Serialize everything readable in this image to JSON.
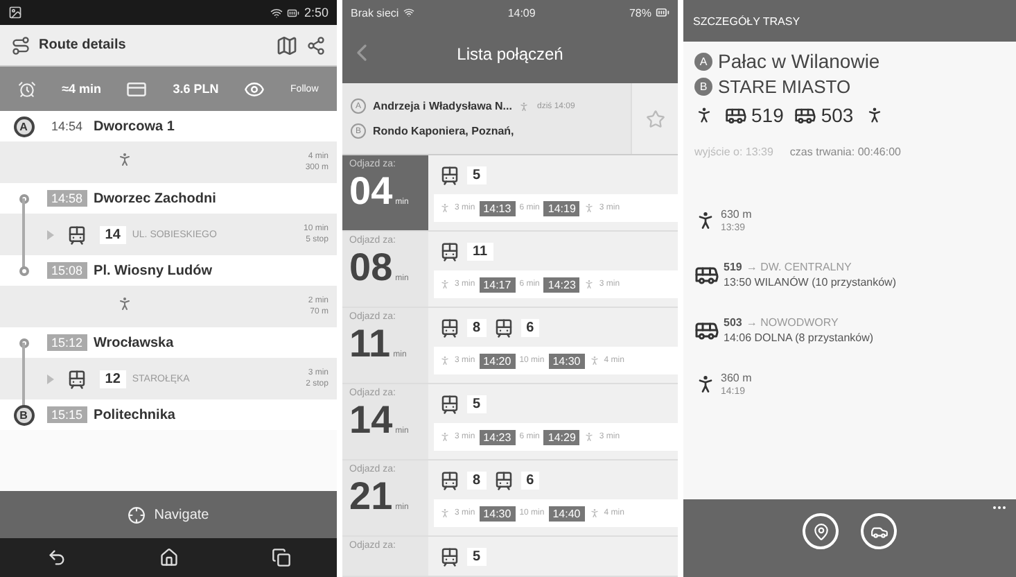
{
  "route_details": {
    "status_bar": {
      "time": "2:50"
    },
    "title": "Route details",
    "summary": {
      "duration": "≈4 min",
      "price": "3.6 PLN",
      "follow": "Follow"
    },
    "steps": [
      {
        "kind": "stop",
        "marker": "A",
        "time": "14:54",
        "name": "Dworcowa 1",
        "boxed": false
      },
      {
        "kind": "walk",
        "duration": "4 min",
        "distance": "300 m"
      },
      {
        "kind": "stop",
        "time": "14:58",
        "name": "Dworzec Zachodni",
        "boxed": true
      },
      {
        "kind": "tram",
        "line": "14",
        "direction": "UL. SOBIESKIEGO",
        "duration": "10 min",
        "stops": "5 stop"
      },
      {
        "kind": "stop",
        "time": "15:08",
        "name": "Pl. Wiosny Ludów",
        "boxed": true
      },
      {
        "kind": "walk",
        "duration": "2 min",
        "distance": "70 m"
      },
      {
        "kind": "stop",
        "time": "15:12",
        "name": "Wrocławska",
        "boxed": true
      },
      {
        "kind": "tram",
        "line": "12",
        "direction": "STAROŁĘKA",
        "duration": "3 min",
        "stops": "2 stop"
      },
      {
        "kind": "stop",
        "marker": "B",
        "time": "15:15",
        "name": "Politechnika",
        "boxed": true
      }
    ],
    "navigate": "Navigate"
  },
  "connections": {
    "status_bar": {
      "carrier": "Brak sieci",
      "time": "14:09",
      "battery": "78%"
    },
    "title": "Lista połączeń",
    "route": {
      "from_marker": "A",
      "from": "Andrzeja i Władysława N...",
      "to_marker": "B",
      "to": "Rondo Kaponiera, Poznań,",
      "info": "dziś 14:09"
    },
    "rows": [
      {
        "label": "Odjazd za:",
        "minutes": "04",
        "unit": "min",
        "selected": true,
        "lines": [
          "5"
        ],
        "legs": [
          {
            "kind": "walk",
            "text": "3 min"
          },
          {
            "kind": "time",
            "text": "14:13"
          },
          {
            "kind": "ride",
            "text": "6 min"
          },
          {
            "kind": "time",
            "text": "14:19"
          },
          {
            "kind": "walk",
            "text": "3 min"
          }
        ]
      },
      {
        "label": "Odjazd za:",
        "minutes": "08",
        "unit": "min",
        "selected": false,
        "lines": [
          "11"
        ],
        "legs": [
          {
            "kind": "walk",
            "text": "3 min"
          },
          {
            "kind": "time",
            "text": "14:17"
          },
          {
            "kind": "ride",
            "text": "6 min"
          },
          {
            "kind": "time",
            "text": "14:23"
          },
          {
            "kind": "walk",
            "text": "3 min"
          }
        ]
      },
      {
        "label": "Odjazd za:",
        "minutes": "11",
        "unit": "min",
        "selected": false,
        "lines": [
          "8",
          "6"
        ],
        "legs": [
          {
            "kind": "walk",
            "text": "3 min"
          },
          {
            "kind": "time",
            "text": "14:20"
          },
          {
            "kind": "ride",
            "text": "10 min"
          },
          {
            "kind": "time",
            "text": "14:30"
          },
          {
            "kind": "walk",
            "text": "4 min"
          }
        ]
      },
      {
        "label": "Odjazd za:",
        "minutes": "14",
        "unit": "min",
        "selected": false,
        "lines": [
          "5"
        ],
        "legs": [
          {
            "kind": "walk",
            "text": "3 min"
          },
          {
            "kind": "time",
            "text": "14:23"
          },
          {
            "kind": "ride",
            "text": "6 min"
          },
          {
            "kind": "time",
            "text": "14:29"
          },
          {
            "kind": "walk",
            "text": "3 min"
          }
        ]
      },
      {
        "label": "Odjazd za:",
        "minutes": "21",
        "unit": "min",
        "selected": false,
        "lines": [
          "8",
          "6"
        ],
        "legs": [
          {
            "kind": "walk",
            "text": "3 min"
          },
          {
            "kind": "time",
            "text": "14:30"
          },
          {
            "kind": "ride",
            "text": "10 min"
          },
          {
            "kind": "time",
            "text": "14:40"
          },
          {
            "kind": "walk",
            "text": "4 min"
          }
        ]
      },
      {
        "label": "Odjazd za:",
        "selected": false,
        "lines": [
          "5"
        ]
      }
    ]
  },
  "trip_details": {
    "title": "SZCZEGÓŁY TRASY",
    "from_marker": "A",
    "from": "Pałac w Wilanowie",
    "to_marker": "B",
    "to": "STARE MIASTO",
    "summary": [
      {
        "kind": "walk"
      },
      {
        "kind": "bus",
        "line": "519"
      },
      {
        "kind": "bus",
        "line": "503"
      },
      {
        "kind": "walk"
      }
    ],
    "departure": "wyjście o: 13:39",
    "duration": "czas trwania: 00:46:00",
    "steps": [
      {
        "kind": "walk",
        "line1": "630 m",
        "line2": "13:39"
      },
      {
        "kind": "bus",
        "line": "519",
        "direction": "→ DW. CENTRALNY",
        "line2": "13:50 WILANÓW (10 przystanków)"
      },
      {
        "kind": "bus",
        "line": "503",
        "direction": "→ NOWODWORY",
        "line2": "14:06 DOLNA (8 przystanków)"
      },
      {
        "kind": "walk",
        "line1": "360 m",
        "line2": "14:19"
      }
    ]
  }
}
